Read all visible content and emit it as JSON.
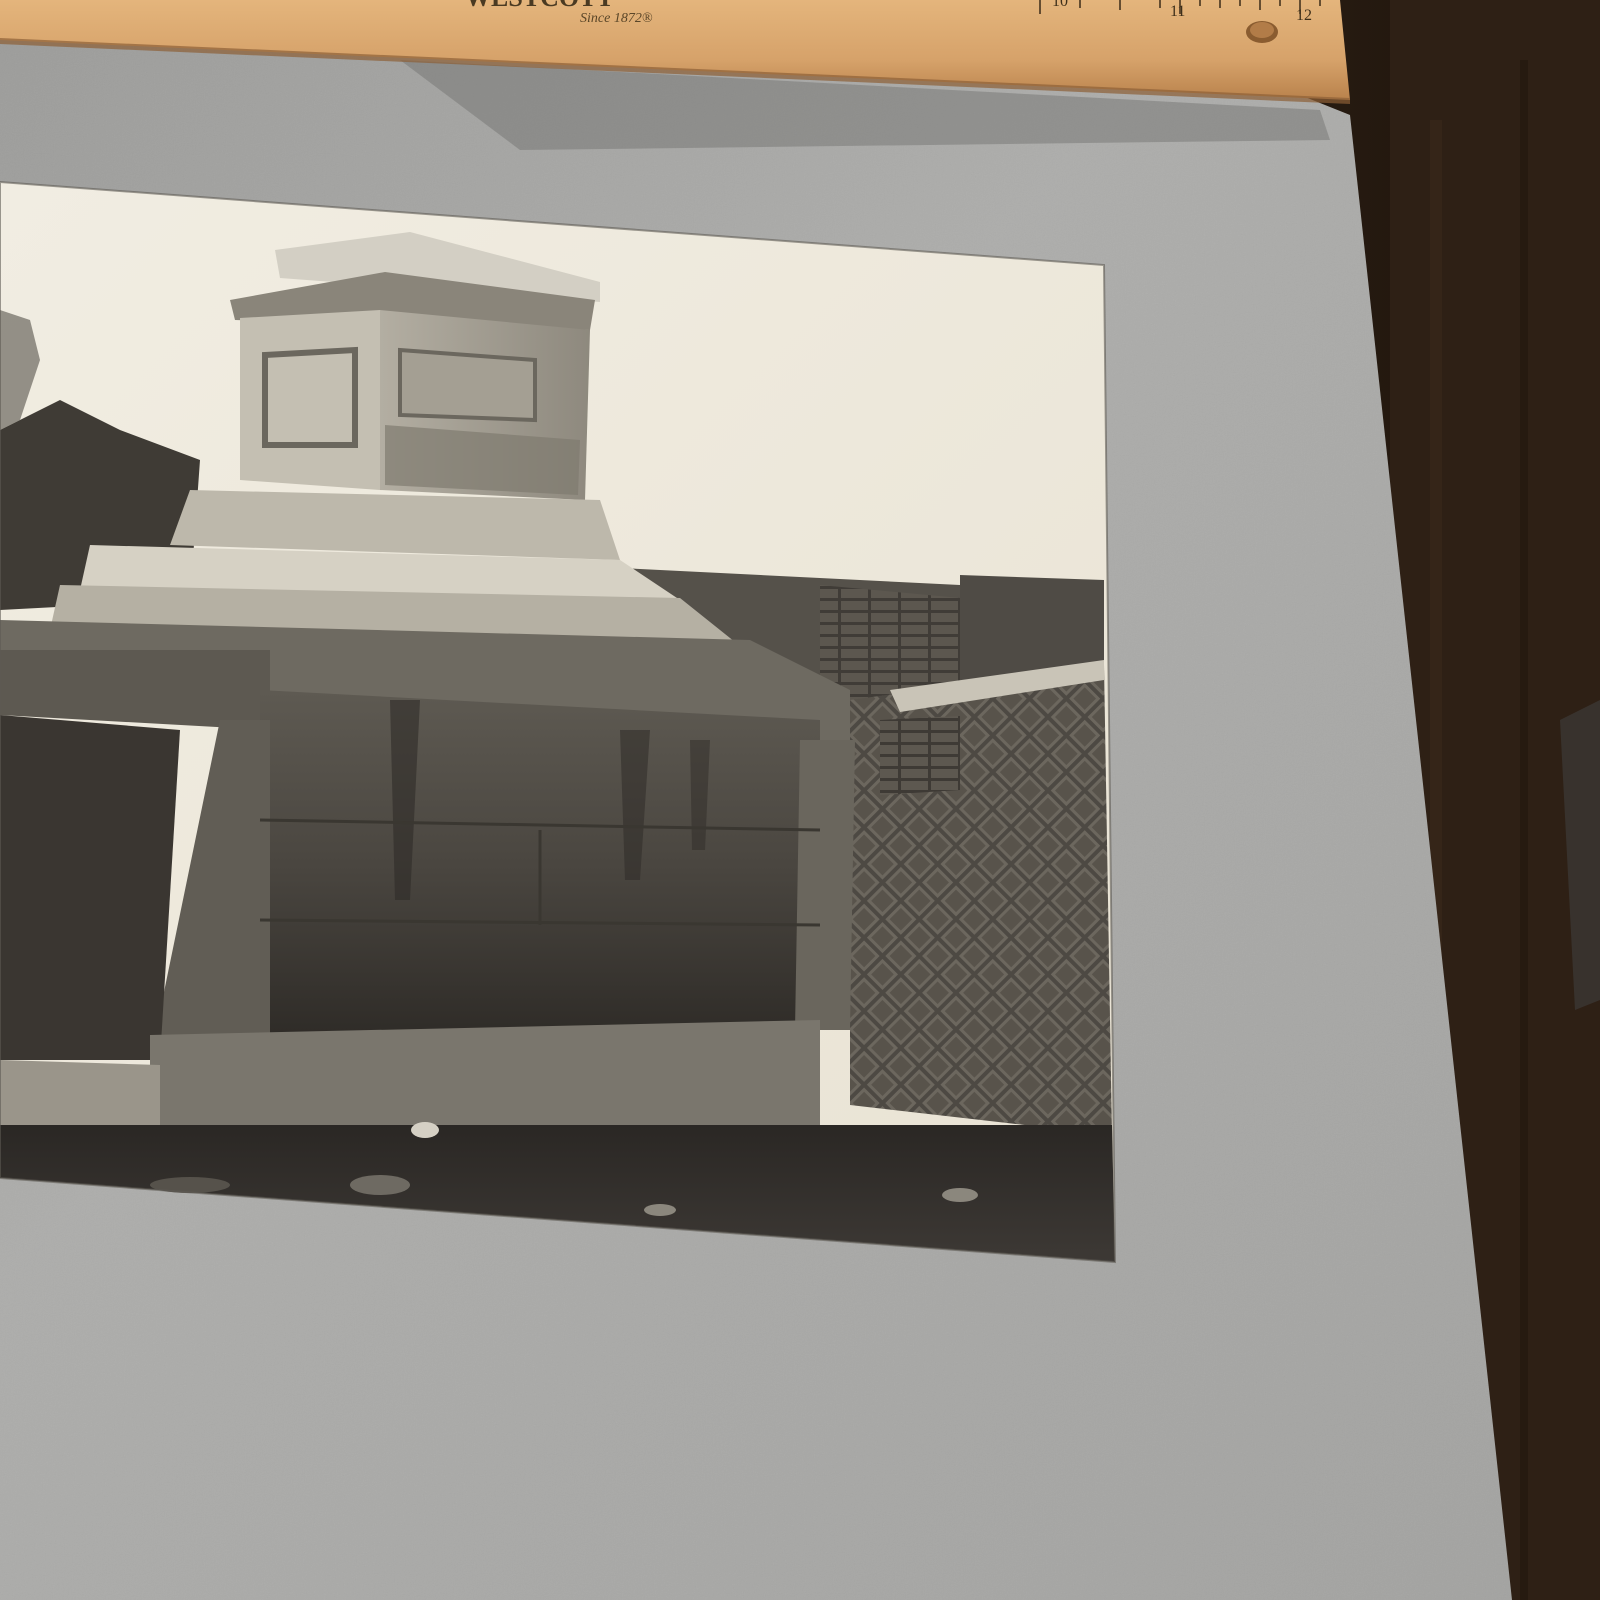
{
  "ruler": {
    "brand": "WESTCOTT",
    "tagline": "Since 1872®",
    "numbers": [
      "10",
      "11",
      "12"
    ]
  },
  "photo": {
    "subject": "stone-tomb-ruins",
    "tone": "black-and-white"
  },
  "colors": {
    "mount_board": "#a9a9a7",
    "photo_sky": "#efeade",
    "ruler_wood": "#d9a870",
    "background_wood": "#2a1d12"
  }
}
